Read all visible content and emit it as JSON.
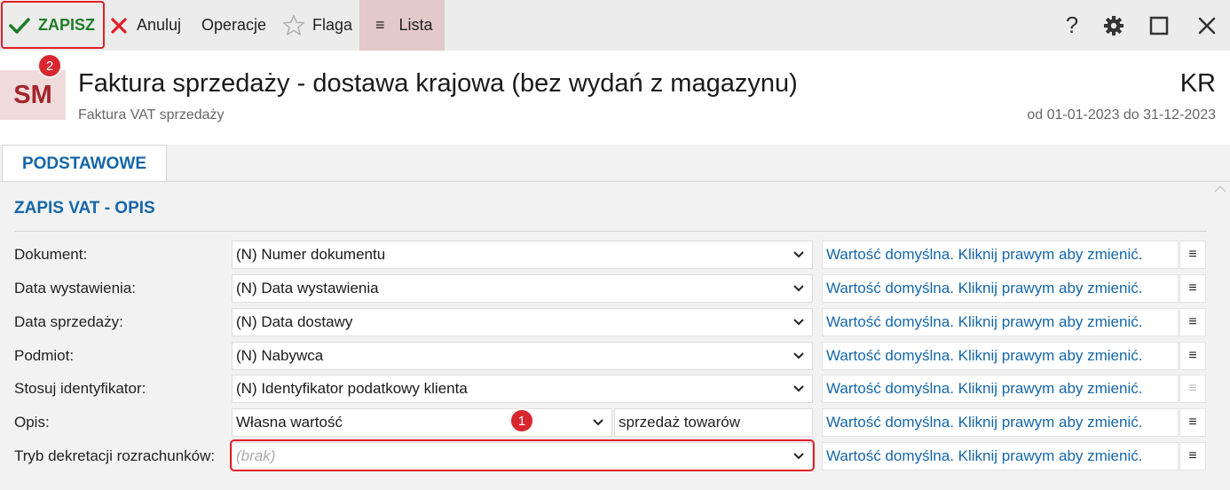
{
  "toolbar": {
    "save_label": "ZAPISZ",
    "cancel_label": "Anuluj",
    "operations_label": "Operacje",
    "flag_label": "Flaga",
    "list_label": "Lista",
    "help_label": "?",
    "icons": [
      "check-icon",
      "x-icon",
      "star-icon",
      "menu-icon",
      "help-icon",
      "gear-icon",
      "maximize-icon",
      "close-icon"
    ],
    "colors": {
      "save": "#1e7d28",
      "cancel": "#e21f26",
      "list_bg": "#e3c9c9"
    }
  },
  "header": {
    "avatar": "SM",
    "title": "Faktura sprzedaży - dostawa krajowa (bez wydań z magazynu)",
    "subtitle": "Faktura VAT sprzedaży",
    "code": "KR",
    "period": "od 01-01-2023 do 31-12-2023"
  },
  "annotations": {
    "badge1": "1",
    "badge2": "2"
  },
  "tabs": [
    {
      "label": "PODSTAWOWE"
    }
  ],
  "section": {
    "title": "ZAPIS VAT - OPIS"
  },
  "rows": [
    {
      "label": "Dokument:",
      "value": "(N) Numer dokumentu",
      "default": "Wartość domyślna. Kliknij prawym aby zmienić.",
      "menu": "≡"
    },
    {
      "label": "Data wystawienia:",
      "value": "(N) Data wystawienia",
      "default": "Wartość domyślna. Kliknij prawym aby zmienić.",
      "menu": "≡"
    },
    {
      "label": "Data sprzedaży:",
      "value": "(N) Data dostawy",
      "default": "Wartość domyślna. Kliknij prawym aby zmienić.",
      "menu": "≡"
    },
    {
      "label": "Podmiot:",
      "value": "(N) Nabywca",
      "default": "Wartość domyślna. Kliknij prawym aby zmienić.",
      "menu": "≡"
    },
    {
      "label": "Stosuj identyfikator:",
      "value": "(N) Identyfikator podatkowy klienta",
      "default": "Wartość domyślna. Kliknij prawym aby zmienić.",
      "menu": "≡"
    },
    {
      "label": "Opis:",
      "value": "Własna wartość",
      "text_value": "sprzedaż towarów",
      "default": "Wartość domyślna. Kliknij prawym aby zmienić.",
      "menu": "≡"
    },
    {
      "label": "Tryb dekretacji rozrachunków:",
      "value": "(brak)",
      "default": "Wartość domyślna. Kliknij prawym aby zmienić.",
      "menu": "≡"
    }
  ]
}
